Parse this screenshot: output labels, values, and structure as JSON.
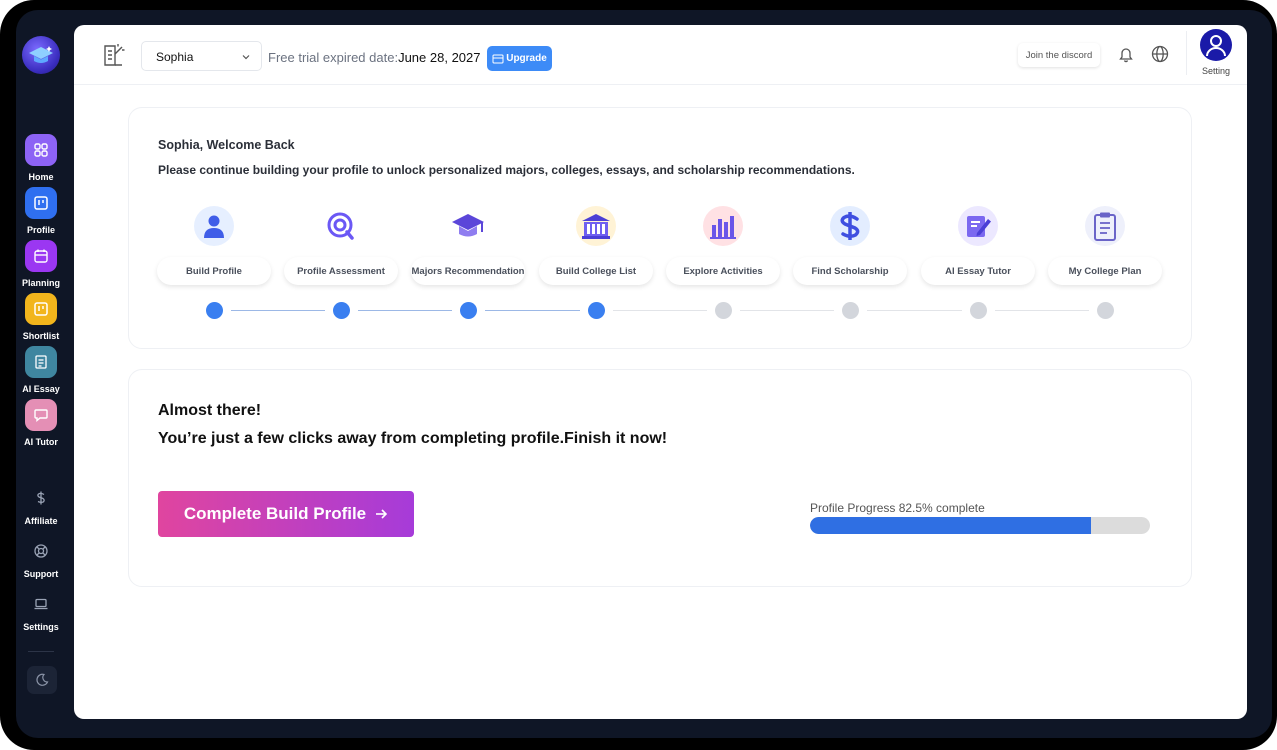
{
  "sidebar": {
    "items": [
      {
        "label": "Home",
        "icon": "grid-icon",
        "color": "#8d63f5"
      },
      {
        "label": "Profile",
        "icon": "board-icon",
        "color": "#2f6ff0"
      },
      {
        "label": "Planning",
        "icon": "calendar-icon",
        "color": "#9b37f2"
      },
      {
        "label": "Shortlist",
        "icon": "list-icon",
        "color": "#f2b51c"
      },
      {
        "label": "AI Essay",
        "icon": "essay-icon",
        "color": "#3f86a0"
      },
      {
        "label": "AI Tutor",
        "icon": "chat-icon",
        "color": "#e48fb5"
      }
    ],
    "bottom_items": [
      {
        "label": "Affiliate",
        "icon": "dollar-icon"
      },
      {
        "label": "Support",
        "icon": "lifebuoy-icon"
      },
      {
        "label": "Settings",
        "icon": "laptop-icon"
      }
    ]
  },
  "topbar": {
    "student": "Sophia",
    "trial_label": "Free trial expired date:",
    "trial_date": "June 28, 2027",
    "upgrade_label": "Upgrade",
    "discord_label": "Join the discord",
    "setting_label": "Setting"
  },
  "welcome": {
    "title": "Sophia, Welcome Back",
    "subtitle": "Please continue building your profile to unlock personalized majors, colleges, essays, and scholarship recommendations.",
    "steps": [
      {
        "label": "Build Profile",
        "icon": "person-icon",
        "done": true
      },
      {
        "label": "Profile Assessment",
        "icon": "magnifier-icon",
        "done": true
      },
      {
        "label": "Majors Recommendation",
        "icon": "graduation-cap-icon",
        "done": true
      },
      {
        "label": "Build College List",
        "icon": "college-building-icon",
        "done": true
      },
      {
        "label": "Explore Activities",
        "icon": "bar-chart-icon",
        "done": false
      },
      {
        "label": "Find Scholarship",
        "icon": "dollar-sign-icon",
        "done": false
      },
      {
        "label": "AI Essay Tutor",
        "icon": "pencil-note-icon",
        "done": false
      },
      {
        "label": "My College Plan",
        "icon": "clipboard-icon",
        "done": false
      }
    ]
  },
  "progress": {
    "headline": "Almost there!",
    "subheadline": "You’re just a few clicks away from completing profile.Finish it now!",
    "cta_label": "Complete Build Profile",
    "progress_label": "Profile Progress 82.5% complete",
    "percent": 82.5
  },
  "colors": {
    "accent_blue": "#3d8bf7",
    "step_done": "#3a7ff0",
    "step_todo": "#d3d6dc",
    "cta_start": "#e0459f",
    "cta_end": "#a63bd9",
    "progress_fill": "#2f6fe3"
  }
}
